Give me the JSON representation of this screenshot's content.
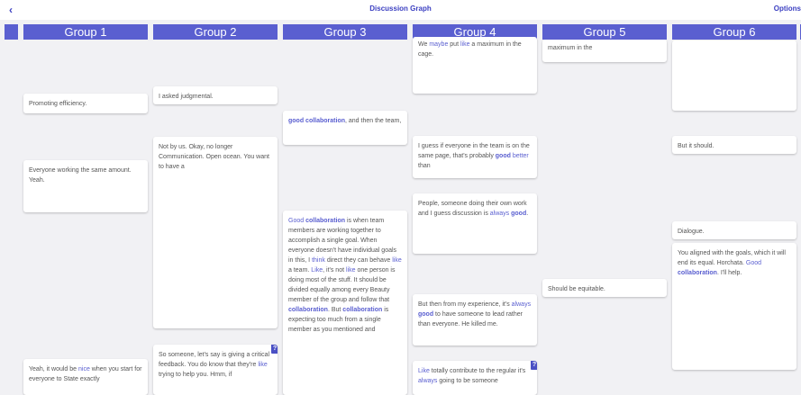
{
  "topbar": {
    "back_icon": "‹",
    "title": "Discussion Graph",
    "options_label": "Options"
  },
  "headers": [
    "Group 1",
    "Group 2",
    "Group 3",
    "Group 4",
    "Group 5",
    "Group 6"
  ],
  "colors": {
    "accent": "#5a5fd0",
    "badge": "#4a50c4"
  },
  "badge_icon": "?",
  "cards": {
    "g1_1": [
      [
        "Promoting efficiency.",
        ""
      ]
    ],
    "g1_2": [
      [
        "Everyone working the same amount. Yeah.",
        ""
      ]
    ],
    "g1_3": [
      [
        "Yeah, it would be ",
        ""
      ],
      [
        "nice",
        "hl"
      ],
      [
        " when you start for everyone to State exactly",
        ""
      ]
    ],
    "g2_1": [
      [
        "I asked judgmental.",
        ""
      ]
    ],
    "g2_2": [
      [
        "Not by us. Okay, no longer Communication. Open ocean. You want to have a",
        ""
      ]
    ],
    "g2_3": [
      [
        "So someone, let's say is giving a critical feedback. You do know that they're ",
        ""
      ],
      [
        "like",
        "hl"
      ],
      [
        " trying to help you. Hmm, if",
        ""
      ]
    ],
    "g3_1": [
      [
        "good collaboration",
        "hl b"
      ],
      [
        ", and then the team,",
        ""
      ]
    ],
    "g3_2": [
      [
        "Good",
        "hl"
      ],
      [
        " ",
        ""
      ],
      [
        "collaboration",
        "hl b"
      ],
      [
        " is when team members are working together to accomplish a single goal. When everyone doesn't have individual goals in this, I ",
        ""
      ],
      [
        "think",
        "hl"
      ],
      [
        " direct they can behave ",
        ""
      ],
      [
        "like",
        "hl"
      ],
      [
        " a team. ",
        ""
      ],
      [
        "Like",
        "hl"
      ],
      [
        ", it's not ",
        ""
      ],
      [
        "like",
        "hl"
      ],
      [
        " one person is doing most of the stuff. It should be divided equally among every Beauty member of the group and follow that ",
        ""
      ],
      [
        "collaboration",
        "hl b"
      ],
      [
        ". But ",
        ""
      ],
      [
        "collaboration",
        "hl b"
      ],
      [
        " is expecting too much from a single member as you mentioned and",
        ""
      ]
    ],
    "g4_1": [
      [
        "We ",
        ""
      ],
      [
        "maybe",
        "hl"
      ],
      [
        " put ",
        ""
      ],
      [
        "like",
        "hl"
      ],
      [
        " a maximum in the cage.",
        ""
      ]
    ],
    "g4_2": [
      [
        "I guess if everyone in the team is on the same page, that's probably ",
        ""
      ],
      [
        "good",
        "hl b"
      ],
      [
        " ",
        ""
      ],
      [
        "better",
        "hl"
      ],
      [
        " than",
        ""
      ]
    ],
    "g4_3": [
      [
        "People, someone doing their own work and I guess discussion is ",
        ""
      ],
      [
        "always",
        "hl"
      ],
      [
        " ",
        ""
      ],
      [
        "good",
        "hl b"
      ],
      [
        ".",
        ""
      ]
    ],
    "g4_4": [
      [
        "But then from my experience, it's ",
        ""
      ],
      [
        "always",
        "hl"
      ],
      [
        " ",
        ""
      ],
      [
        "good",
        "hl b"
      ],
      [
        " to have someone to lead rather than everyone. He killed me.",
        ""
      ]
    ],
    "g4_5": [
      [
        "Like",
        "hl"
      ],
      [
        " totally contribute to the regular it's ",
        ""
      ],
      [
        "always",
        "hl"
      ],
      [
        " going to be someone",
        ""
      ]
    ],
    "g5_1": [
      [
        "maximum in the",
        ""
      ]
    ],
    "g5_2": [
      [
        "Should be equitable.",
        ""
      ]
    ],
    "g6_1": [
      [
        "But it should.",
        ""
      ]
    ],
    "g6_2": [
      [
        "Dialogue.",
        ""
      ]
    ],
    "g6_3": [
      [
        "You aligned with the goals, which it will end its equal. Horchata. ",
        ""
      ],
      [
        "Good",
        "hl"
      ],
      [
        " ",
        ""
      ],
      [
        "collaboration",
        "hl b"
      ],
      [
        ". I'll help.",
        ""
      ]
    ]
  }
}
